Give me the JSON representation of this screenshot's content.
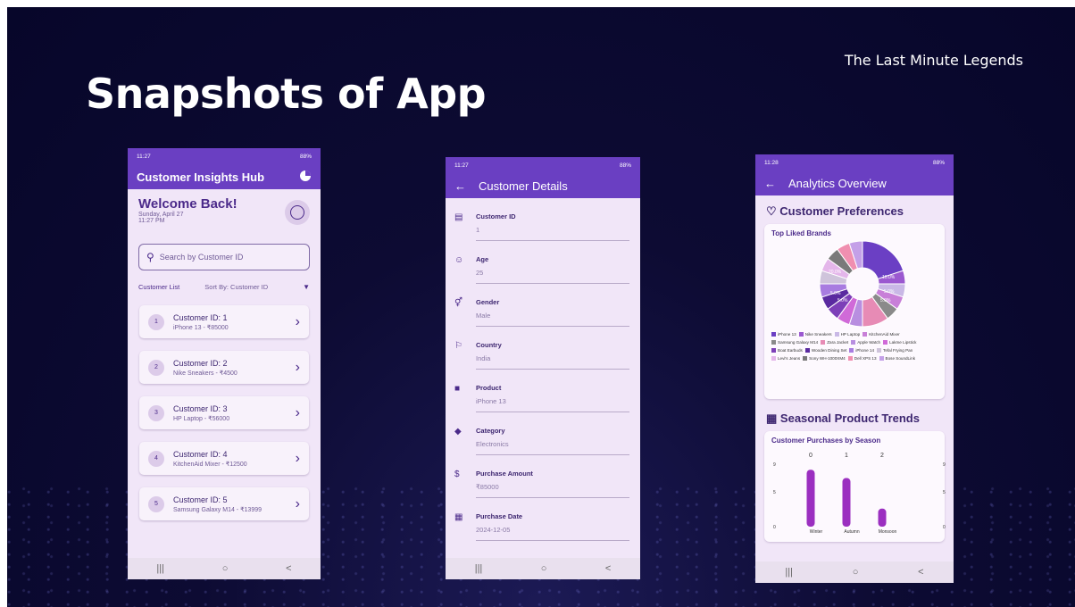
{
  "slide": {
    "title": "Snapshots of App",
    "team": "The Last Minute Legends"
  },
  "phone1": {
    "status": {
      "time": "11:27",
      "battery": "88%"
    },
    "app_title": "Customer Insights Hub",
    "welcome": "Welcome Back!",
    "date": "Sunday, April 27",
    "time": "11:27 PM",
    "search_placeholder": "Search by Customer ID",
    "list_label": "Customer List",
    "sort_label": "Sort By:  Customer ID",
    "customers": [
      {
        "num": "1",
        "title": "Customer ID: 1",
        "sub": "iPhone 13 - ₹85000"
      },
      {
        "num": "2",
        "title": "Customer ID: 2",
        "sub": "Nike Sneakers - ₹4500"
      },
      {
        "num": "3",
        "title": "Customer ID: 3",
        "sub": "HP Laptop - ₹56000"
      },
      {
        "num": "4",
        "title": "Customer ID: 4",
        "sub": "KitchenAid Mixer - ₹12500"
      },
      {
        "num": "5",
        "title": "Customer ID: 5",
        "sub": "Samsung Galaxy M14 - ₹13999"
      }
    ]
  },
  "phone2": {
    "status": {
      "time": "11:27",
      "battery": "88%"
    },
    "app_title": "Customer Details",
    "fields": [
      {
        "label": "Customer ID",
        "value": "1"
      },
      {
        "label": "Age",
        "value": "25"
      },
      {
        "label": "Gender",
        "value": "Male"
      },
      {
        "label": "Country",
        "value": "India"
      },
      {
        "label": "Product",
        "value": "iPhone 13"
      },
      {
        "label": "Category",
        "value": "Electronics"
      },
      {
        "label": "Purchase Amount",
        "value": "₹85000"
      },
      {
        "label": "Purchase Date",
        "value": "2024-12-05"
      }
    ]
  },
  "phone3": {
    "status": {
      "time": "11:28",
      "battery": "88%"
    },
    "app_title": "Analytics Overview",
    "sec1": "Customer Preferences",
    "sec2": "Seasonal Product Trends"
  },
  "chart_data": [
    {
      "type": "pie",
      "title": "Top Liked Brands",
      "slice_labels": [
        "20.0%",
        "10.0%",
        "5.0%",
        "5.0%",
        "5.0%",
        "5.0%"
      ],
      "categories": [
        "iPhone 13",
        "Nike Sneakers",
        "HP Laptop",
        "KitchenAid Mixer",
        "Samsung Galaxy M14",
        "Zara Jacket",
        "Apple Watch",
        "Lakme Lipstick",
        "Boat Earbuds",
        "Wooden Dining Set",
        "iPhone 14",
        "Tefal Frying Pan",
        "Levi's Jeans",
        "Sony WH-1000XM4",
        "Dell XPS 13",
        "Bose SoundLink"
      ],
      "values": [
        20,
        5,
        5,
        5,
        5,
        10,
        5,
        5,
        5,
        5,
        5,
        5,
        5,
        5,
        5,
        5
      ],
      "colors": [
        "#6b3fc4",
        "#9b59d0",
        "#c9b8e6",
        "#c87fd8",
        "#8a8a8a",
        "#e78bb5",
        "#b88ee0",
        "#d06ad8",
        "#7d3fb8",
        "#5a2aa0",
        "#a87ce0",
        "#cfc4db",
        "#e4b6ea",
        "#7a7a7a",
        "#f08fb0",
        "#c4a0e8"
      ],
      "legend": "bottom"
    },
    {
      "type": "bar",
      "title": "Customer Purchases by Season",
      "categories": [
        "Winter",
        "Autumn",
        "Monsoon"
      ],
      "top_labels": [
        "0",
        "1",
        "2"
      ],
      "values": [
        8.2,
        7.0,
        2.6
      ],
      "yticks": [
        "0",
        "5",
        "9"
      ],
      "ylim": [
        0,
        9
      ],
      "color": "#9b2fc0"
    }
  ]
}
